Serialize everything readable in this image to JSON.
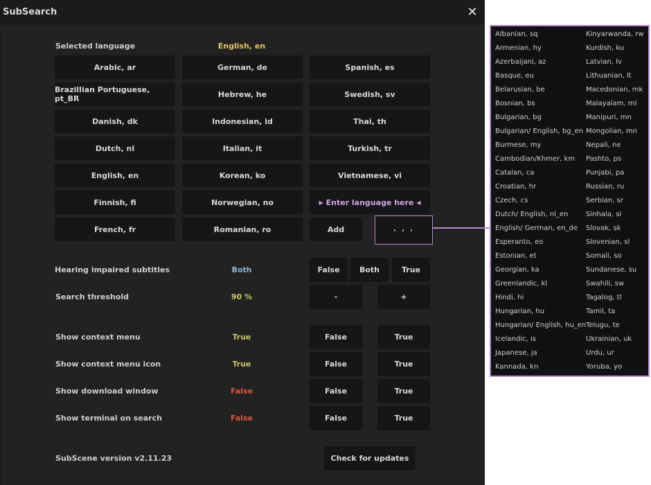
{
  "window": {
    "title": "SubSearch",
    "close_label": "✕"
  },
  "language": {
    "label": "Selected language",
    "value": "English, en",
    "buttons": [
      "Arabic, ar",
      "German, de",
      "Spanish, es",
      "Brazillian Portuguese, pt_BR",
      "Hebrew, he",
      "Swedish, sv",
      "Danish, dk",
      "Indonesian, id",
      "Thai, th",
      "Dutch, nl",
      "Italian, it",
      "Turkish, tr",
      "English, en",
      "Korean, ko",
      "Vietnamese, vi",
      "Finnish, fi",
      "Norwegian, no",
      "French, fr",
      "Romanian, ro"
    ],
    "enter_placeholder": "Enter language here",
    "add_label": "Add",
    "more_label": "· · ·"
  },
  "hearing": {
    "label": "Hearing impaired subtitles",
    "value": "Both",
    "options": [
      "False",
      "Both",
      "True"
    ]
  },
  "threshold": {
    "label": "Search threshold",
    "value": "90 %",
    "minus": "-",
    "plus": "+"
  },
  "toggles": [
    {
      "label": "Show context menu",
      "value": "True",
      "false_label": "False",
      "true_label": "True"
    },
    {
      "label": "Show context menu icon",
      "value": "True",
      "false_label": "False",
      "true_label": "True"
    },
    {
      "label": "Show download window",
      "value": "False",
      "false_label": "False",
      "true_label": "True"
    },
    {
      "label": "Show terminal on search",
      "value": "False",
      "false_label": "False",
      "true_label": "True"
    }
  ],
  "footer": {
    "version": "SubScene version v2.11.23",
    "update_button": "Check for updates"
  },
  "language_list": {
    "left": [
      "Albanian, sq",
      "Armenian, hy",
      "Azerbaijani, az",
      "Basque, eu",
      "Belarusian, be",
      "Bosnian, bs",
      "Bulgarian, bg",
      "Bulgarian/ English, bg_en",
      "Burmese, my",
      "Cambodian/Khmer, km",
      "Catalan, ca",
      "Croatian, hr",
      "Czech, cs",
      "Dutch/ English, nl_en",
      "English/ German, en_de",
      "Esperanto, eo",
      "Estonian, et",
      "Georgian, ka",
      "Greenlandic, kl",
      "Hindi, hi",
      "Hungarian, hu",
      "Hungarian/ English, hu_en",
      "Icelandic, is",
      "Japanese, ja",
      "Kannada, kn"
    ],
    "right": [
      "Kinyarwanda, rw",
      "Kurdish, ku",
      "Latvian, lv",
      "Lithuanian, lt",
      "Macedonian, mk",
      "Malayalam, ml",
      "Manipuri, mn",
      "Mongolian, mn",
      "Nepali, ne",
      "Pashto, ps",
      "Punjabi, pa",
      "Russian, ru",
      "Serbian, sr",
      "Sinhala, si",
      "Slovak, sk",
      "Slovenian, sl",
      "Somali, so",
      "Sundanese, su",
      "Swahili, sw",
      "Tagalog, tl",
      "Tamil, ta",
      "Telugu, te",
      "Ukrainian, uk",
      "Urdu, ur",
      "Yoruba, yo"
    ]
  },
  "colors": {
    "selected_language": "#e8c46a",
    "value_both": "#8fb3d0",
    "value_true": "#c7c46e",
    "value_false": "#e0553f",
    "threshold_value": "#c7c46e",
    "accent": "#b48bc9"
  }
}
